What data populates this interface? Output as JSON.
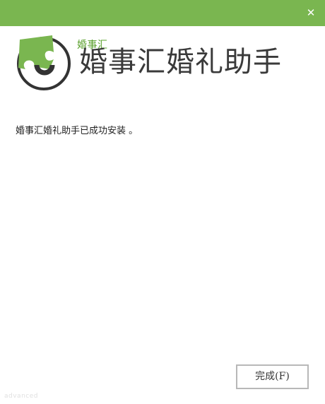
{
  "window": {
    "close_glyph": "✕",
    "accent": "#7ab650"
  },
  "header": {
    "logo_icon": "puzzle-disc-logo-icon",
    "brand_small": "婚事汇",
    "brand_large": "婚事汇婚礼助手"
  },
  "main": {
    "message": "婚事汇婚礼助手已成功安装 。"
  },
  "footer": {
    "finish_label": "完成(F)",
    "advanced_label": "advanced"
  }
}
